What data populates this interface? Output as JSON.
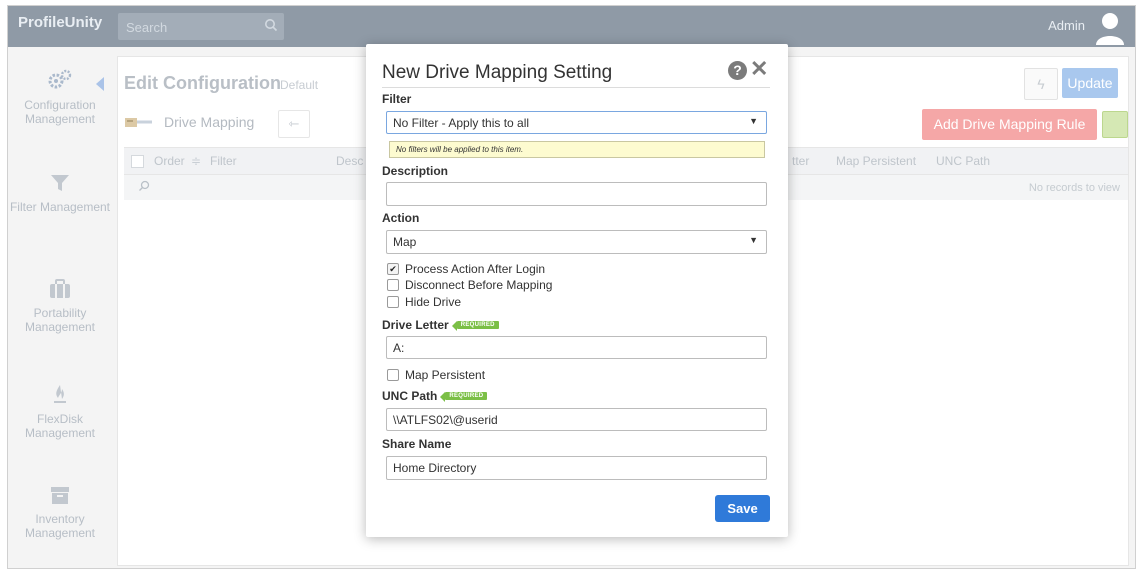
{
  "app": {
    "brand": "ProfileUnity",
    "search_placeholder": "Search",
    "user": "Admin"
  },
  "sidebar": {
    "items": [
      {
        "label": "Configuration Management"
      },
      {
        "label": "Filter Management"
      },
      {
        "label": "Portability Management"
      },
      {
        "label": "FlexDisk Management"
      },
      {
        "label": "Inventory Management"
      }
    ]
  },
  "page": {
    "title": "Edit Configuration",
    "subtitle": "Default",
    "update_label": "Update",
    "section_title": "Drive Mapping",
    "add_rule_label": "Add Drive Mapping Rule",
    "columns": [
      "Order",
      "Filter",
      "Desc",
      "tter",
      "Map Persistent",
      "UNC Path"
    ],
    "no_records": "No records to view"
  },
  "modal": {
    "title": "New Drive Mapping Setting",
    "filter_label": "Filter",
    "filter_value": "No Filter - Apply this to all",
    "filter_tip": "No filters will be applied to this item.",
    "description_label": "Description",
    "description_value": "",
    "action_label": "Action",
    "action_value": "Map",
    "options": [
      {
        "label": "Process Action After Login",
        "checked": true
      },
      {
        "label": "Disconnect Before Mapping",
        "checked": false
      },
      {
        "label": "Hide Drive",
        "checked": false
      }
    ],
    "drive_letter_label": "Drive Letter",
    "required_badge": "REQUIRED",
    "drive_letter_value": "A:",
    "map_persistent_label": "Map Persistent",
    "map_persistent_checked": false,
    "unc_label": "UNC Path",
    "unc_value": "\\\\ATLFS02\\@userid",
    "share_label": "Share Name",
    "share_value": "Home Directory",
    "save_label": "Save"
  },
  "colors": {
    "accent": "#2f7ad9",
    "required": "#7bbf46",
    "add_rule": "#f5a7a7",
    "topbar": "#8f9aa6"
  }
}
